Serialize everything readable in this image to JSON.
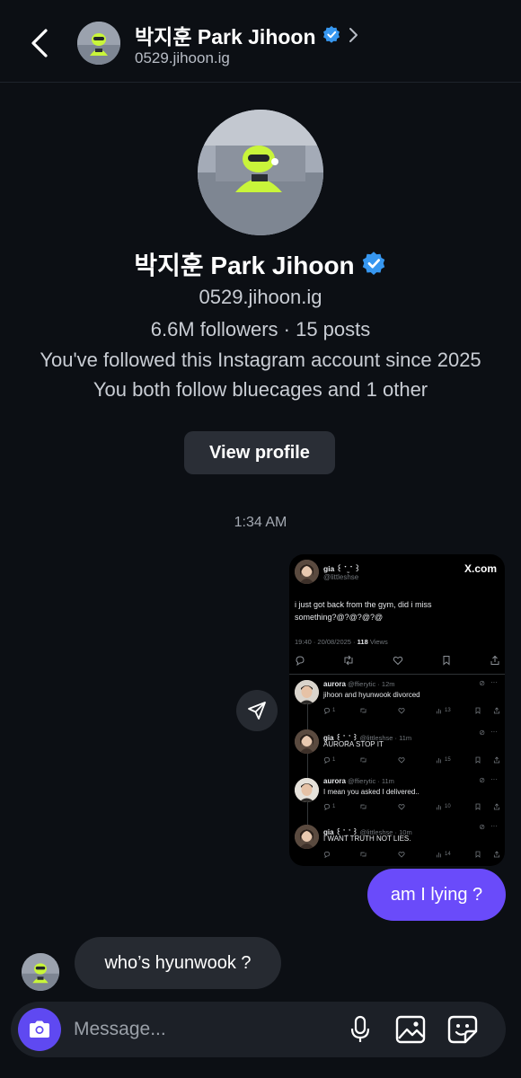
{
  "header": {
    "title": "박지훈 Park Jihoon",
    "username": "0529.jihoon.ig"
  },
  "profile": {
    "name": "박지훈 Park Jihoon",
    "username": "0529.jihoon.ig",
    "stats": "6.6M followers · 15 posts",
    "follow_since": "You've followed this Instagram account since 2025",
    "mutual": "You both follow bluecages and 1 other",
    "view_profile_label": "View profile"
  },
  "conversation": {
    "timestamp": "1:34 AM",
    "shared_post": {
      "source": "X.com",
      "author": "gia ꒰ ་ ̫ ་ ꒱",
      "handle": "@littleshse",
      "text_line1": "i just got back from the gym, did i miss",
      "text_line2": "something?@?@?@?@",
      "meta": "19:40 · 20/08/2025 · ",
      "views_count": "118",
      "views_label": " Views",
      "replies": [
        {
          "author": "aurora",
          "meta": "@ffierytic · 12m",
          "text": "jihoon and hyunwook divorced",
          "likes": "1",
          "views": "13"
        },
        {
          "author": "gia ꒰ ་ ̫ ་ ꒱",
          "meta": "@littleshse · 11m",
          "text": "AURORA STOP IT",
          "likes": "1",
          "views": "15"
        },
        {
          "author": "aurora",
          "meta": "@ffierytic · 11m",
          "text": "I mean you asked I delivered..",
          "likes": "1",
          "views": "10"
        },
        {
          "author": "gia ꒰ ་ ̫ ་ ꒱",
          "meta": "@littleshse · 10m",
          "text": "I WANT TRUTH NOT LIES.",
          "likes": "",
          "views": "14"
        }
      ]
    },
    "sent_message": "am I lying ?",
    "received_message": "who’s hyunwook ?"
  },
  "composer": {
    "placeholder": "Message..."
  },
  "colors": {
    "background": "#0c0f14",
    "accent": "#6a4bfa",
    "bubble_received": "#262a31",
    "verified_badge": "#3797f0",
    "avatar_neon": "#c9f53a"
  },
  "icons": [
    "back-chevron-icon",
    "verified-badge-icon",
    "chevron-right-icon",
    "send-icon",
    "camera-icon",
    "microphone-icon",
    "gallery-icon",
    "sticker-icon",
    "x-logo-icon",
    "reply-icon",
    "retweet-icon",
    "like-icon",
    "bookmark-icon",
    "share-icon",
    "views-icon",
    "grok-icon",
    "more-icon"
  ]
}
